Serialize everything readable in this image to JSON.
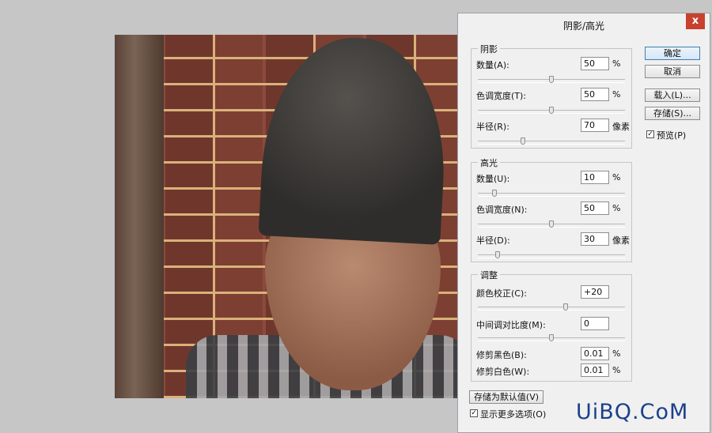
{
  "dialog": {
    "title": "阴影/高光",
    "close_glyph": "x",
    "shadows": {
      "legend": "阴影",
      "amount": {
        "label": "数量(A):",
        "value": "50",
        "unit": "%",
        "slider_fraction": 0.5
      },
      "tonal_width": {
        "label": "色调宽度(T):",
        "value": "50",
        "unit": "%",
        "slider_fraction": 0.5
      },
      "radius": {
        "label": "半径(R):",
        "value": "70",
        "unit": "像素",
        "slider_fraction": 0.3
      }
    },
    "highlights": {
      "legend": "高光",
      "amount": {
        "label": "数量(U):",
        "value": "10",
        "unit": "%",
        "slider_fraction": 0.1
      },
      "tonal_width": {
        "label": "色调宽度(N):",
        "value": "50",
        "unit": "%",
        "slider_fraction": 0.5
      },
      "radius": {
        "label": "半径(D):",
        "value": "30",
        "unit": "像素",
        "slider_fraction": 0.12
      }
    },
    "adjustments": {
      "legend": "调整",
      "color_correction": {
        "label": "颜色校正(C):",
        "value": "+20",
        "slider_fraction": 0.6
      },
      "midtone_contrast": {
        "label": "中间调对比度(M):",
        "value": "0",
        "slider_fraction": 0.5
      },
      "black_clip": {
        "label": "修剪黑色(B):",
        "value": "0.01",
        "unit": "%"
      },
      "white_clip": {
        "label": "修剪白色(W):",
        "value": "0.01",
        "unit": "%"
      }
    },
    "buttons": {
      "ok": "确定",
      "cancel": "取消",
      "load": "载入(L)...",
      "save": "存储(S)...",
      "save_defaults": "存储为默认值(V)"
    },
    "preview": {
      "label": "预览(P)",
      "checked": true
    },
    "more_options": {
      "label": "显示更多选项(O)",
      "checked": true
    }
  },
  "watermark": "UiBQ.CoM",
  "colors": {
    "close_button": "#c7412e",
    "ok_border": "#3c7fb1",
    "watermark": "#1c3f8a"
  }
}
